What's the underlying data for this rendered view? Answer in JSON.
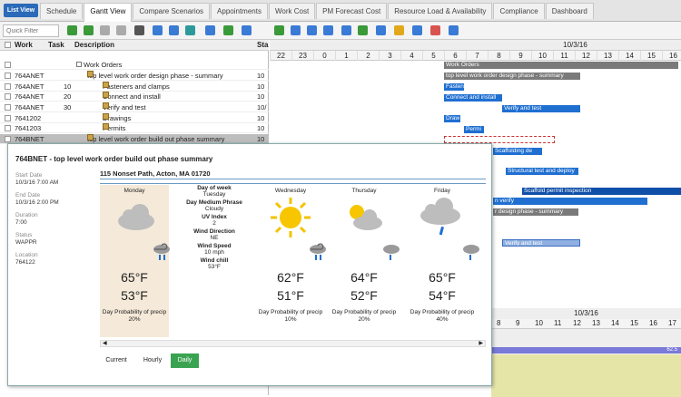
{
  "listview": "List View",
  "tabs": [
    "Schedule",
    "Gantt View",
    "Compare Scenarios",
    "Appointments",
    "Work Cost",
    "PM Forecast Cost",
    "Resource Load & Availability",
    "Compliance",
    "Dashboard"
  ],
  "active_tab_index": 1,
  "quick_filter": {
    "placeholder": "Quick Filter"
  },
  "grid": {
    "headers": {
      "work": "Work",
      "task": "Task",
      "description": "Description",
      "status": "Sta"
    },
    "rows": [
      {
        "work": "",
        "task": "",
        "description": "Work Orders",
        "status": ""
      },
      {
        "work": "764ANET",
        "task": "",
        "description": "top level work order design phase - summary",
        "status": "10"
      },
      {
        "work": "764ANET",
        "task": "10",
        "description": "Fasteners and clamps",
        "status": "10"
      },
      {
        "work": "764ANET",
        "task": "20",
        "description": "Connect and install",
        "status": "10"
      },
      {
        "work": "764ANET",
        "task": "30",
        "description": "Verify and test",
        "status": "10/"
      },
      {
        "work": "7641202",
        "task": "",
        "description": "Drawings",
        "status": "10"
      },
      {
        "work": "7641203",
        "task": "",
        "description": "Permits",
        "status": "10"
      },
      {
        "work": "764BNET",
        "task": "",
        "description": "top level work order build out phase summary",
        "status": "10"
      }
    ]
  },
  "gantt": {
    "date": "10/3/16",
    "hours": [
      "22",
      "23",
      "0",
      "1",
      "2",
      "3",
      "4",
      "5",
      "6",
      "7",
      "8",
      "9",
      "10",
      "11",
      "12",
      "13",
      "14",
      "15",
      "16",
      "17"
    ],
    "bars": [
      "Work Orders",
      "top level work order design phase - summary",
      "Fasten",
      "Connect and install",
      "Verify and test",
      "Draw",
      "Permi",
      "Scaffolding de",
      "Structural test and deploy",
      "Scaffold permit inspection",
      "n verify",
      "r design phase - summary",
      "Verify and test"
    ],
    "lower_date": "10/3/16",
    "lower_hours": [
      "8",
      "9",
      "10",
      "11",
      "12",
      "13",
      "14",
      "15",
      "16",
      "17"
    ],
    "lower_value": "62.5"
  },
  "popup": {
    "title": "764BNET - top level work order build out phase summary",
    "start_label": "Start Date",
    "start_value": "10/3/16 7:00 AM",
    "end_label": "End Date",
    "end_value": "10/3/16 2:00 PM",
    "duration_label": "Duration",
    "duration_value": "7:00",
    "status_label": "Status",
    "status_value": "WAPPR",
    "location_label": "Location",
    "location_value": "764122",
    "address": "115 Nonset Path, Acton, MA 01720",
    "detail": {
      "dow_k": "Day of week",
      "dow_v": "Tuesday",
      "phrase_k": "Day Medium Phrase",
      "phrase_v": "Cloudy",
      "uv_k": "UV Index",
      "uv_v": "2",
      "wdir_k": "Wind Direction",
      "wdir_v": "NE",
      "wspd_k": "Wind Speed",
      "wspd_v": "10 mph",
      "chill_k": "Wind chill",
      "chill_v": "53°F"
    },
    "days": [
      {
        "name": "Monday",
        "high": "65°F",
        "low": "53°F",
        "precip_label": "Day Probability of precip",
        "precip": "20%"
      },
      {
        "name": "Wednesday",
        "high": "62°F",
        "low": "51°F",
        "precip_label": "Day Probability of precip",
        "precip": "10%"
      },
      {
        "name": "Thursday",
        "high": "64°F",
        "low": "52°F",
        "precip_label": "Day Probability of precip",
        "precip": "20%"
      },
      {
        "name": "Friday",
        "high": "65°F",
        "low": "54°F",
        "precip_label": "Day Probability of precip",
        "precip": "40%"
      }
    ],
    "bottom_tabs": [
      "Current",
      "Hourly",
      "Daily"
    ]
  },
  "colors": {
    "accent": "#1f6fd1",
    "daily_tab": "#3aa352",
    "monday_bg": "#f5ead9"
  }
}
